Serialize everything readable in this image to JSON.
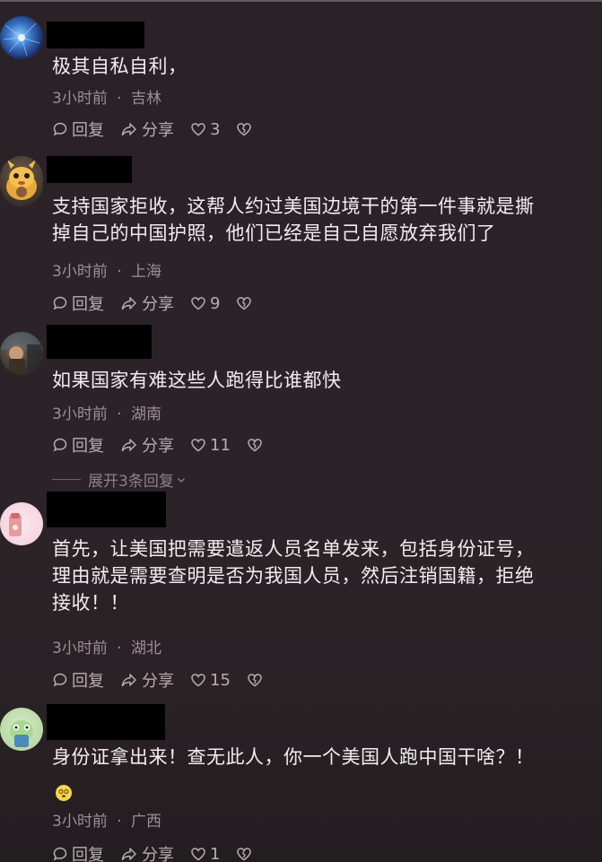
{
  "comments": [
    {
      "text": "极其自私自利，",
      "time": "3小时前",
      "location": "吉林",
      "reply_label": "回复",
      "share_label": "分享",
      "likes": "3"
    },
    {
      "text": "支持国家拒收，这帮人约过美国边境干的第一件事就是撕\n掉自己的中国护照，他们已经是自己自愿放弃我们了",
      "time": "3小时前",
      "location": "上海",
      "reply_label": "回复",
      "share_label": "分享",
      "likes": "9"
    },
    {
      "text": "如果国家有难这些人跑得比谁都快",
      "time": "3小时前",
      "location": "湖南",
      "reply_label": "回复",
      "share_label": "分享",
      "likes": "11",
      "expand_label": "展开3条回复"
    },
    {
      "text": "首先，让美国把需要遣返人员名单发来，包括身份证号，\n理由就是需要查明是否为我国人员，然后注销国籍，拒绝\n接收！！",
      "time": "3小时前",
      "location": "湖北",
      "reply_label": "回复",
      "share_label": "分享",
      "likes": "15"
    },
    {
      "text": "身份证拿出来！查无此人，你一个美国人跑中国干啥？！",
      "time": "3小时前",
      "location": "广西",
      "reply_label": "回复",
      "share_label": "分享",
      "likes": "1"
    }
  ],
  "separator": "·",
  "colors": {
    "background": "#2a2227",
    "text": "#f2eef0",
    "meta": "#9b9094",
    "redaction": "#000000"
  },
  "icons": {
    "reply": "comment-bubble-icon",
    "share": "share-arrow-icon",
    "like": "heart-icon",
    "dislike": "broken-heart-icon",
    "expand": "chevron-down-icon"
  }
}
